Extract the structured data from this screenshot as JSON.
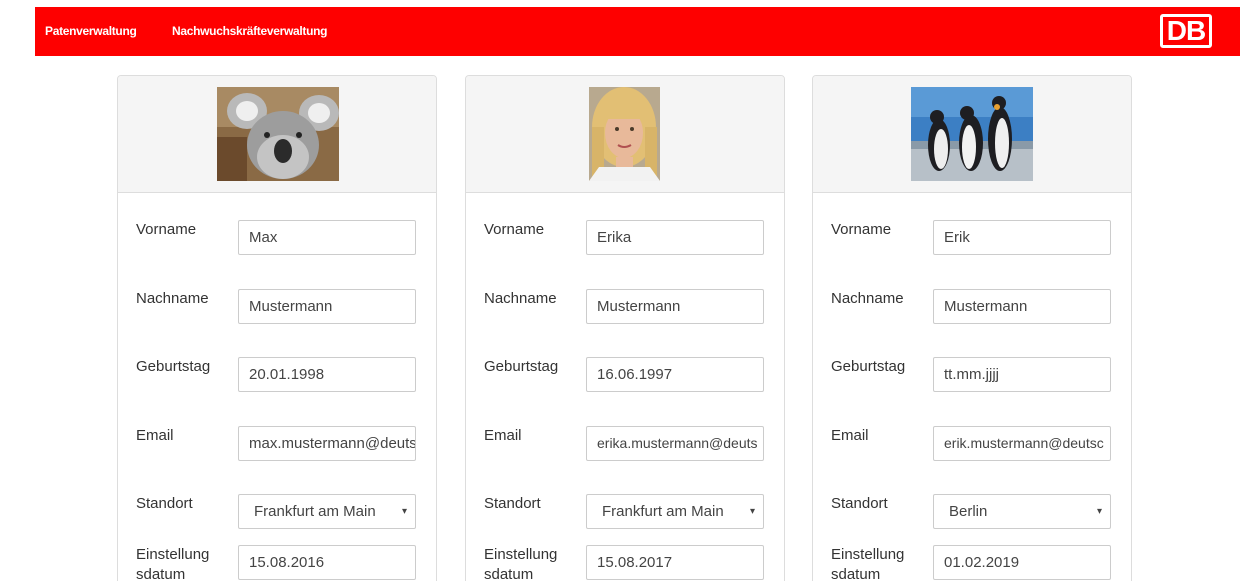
{
  "nav": {
    "items": [
      "Patenverwaltung",
      "Nachwuchskräfteverwaltung"
    ],
    "logo": "DB",
    "color": "#fe0000"
  },
  "labels": {
    "vorname": "Vorname",
    "nachname": "Nachname",
    "geburtstag": "Geburtstag",
    "email": "Email",
    "standort": "Standort",
    "einstellung_line1": "Einstellung",
    "einstellung_line2": "sdatum"
  },
  "cards": [
    {
      "photo": "koala-photo",
      "vorname": "Max",
      "nachname": "Mustermann",
      "geburtstag": "20.01.1998",
      "email": "max.mustermann@deuts",
      "standort": "Frankfurt am Main",
      "einstellungsdatum": "15.08.2016"
    },
    {
      "photo": "woman-portrait-photo",
      "vorname": "Erika",
      "nachname": "Mustermann",
      "geburtstag": "16.06.1997",
      "email": "erika.mustermann@deuts",
      "standort": "Frankfurt am Main",
      "einstellungsdatum": "15.08.2017"
    },
    {
      "photo": "penguins-photo",
      "vorname": "Erik",
      "nachname": "Mustermann",
      "geburtstag": "tt.mm.jjjj",
      "email": "erik.mustermann@deutsc",
      "standort": "Berlin",
      "einstellungsdatum": "01.02.2019"
    }
  ],
  "select_caret": "▾"
}
